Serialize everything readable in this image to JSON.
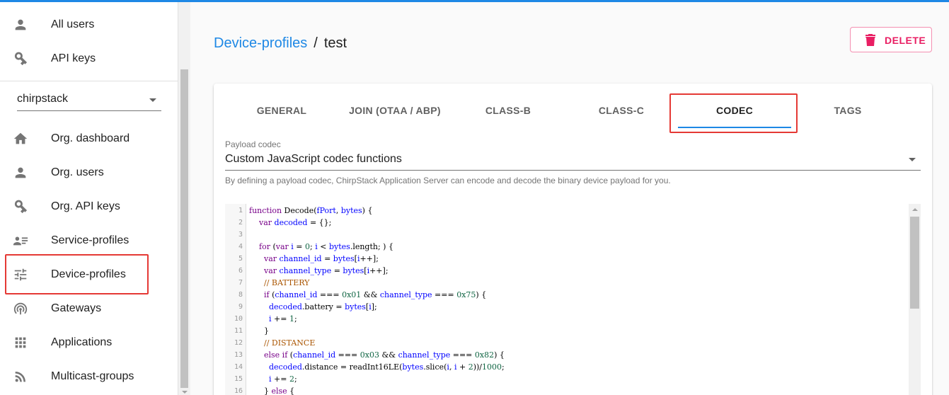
{
  "sidebar": {
    "top_items": [
      {
        "label": "All users",
        "icon": "person-icon"
      },
      {
        "label": "API keys",
        "icon": "key-icon"
      }
    ],
    "org_select": {
      "value": "chirpstack"
    },
    "org_items": [
      {
        "label": "Org. dashboard",
        "icon": "home-icon"
      },
      {
        "label": "Org. users",
        "icon": "person-icon"
      },
      {
        "label": "Org. API keys",
        "icon": "key-icon"
      },
      {
        "label": "Service-profiles",
        "icon": "account-details-icon"
      },
      {
        "label": "Device-profiles",
        "icon": "tune-icon"
      },
      {
        "label": "Gateways",
        "icon": "radio-tower-icon"
      },
      {
        "label": "Applications",
        "icon": "apps-grid-icon"
      },
      {
        "label": "Multicast-groups",
        "icon": "rss-icon"
      }
    ]
  },
  "header": {
    "breadcrumb_link": "Device-profiles",
    "breadcrumb_sep": "/",
    "breadcrumb_current": "test",
    "delete_label": "DELETE"
  },
  "tabs": [
    "GENERAL",
    "JOIN (OTAA / ABP)",
    "CLASS-B",
    "CLASS-C",
    "CODEC",
    "TAGS"
  ],
  "active_tab": "CODEC",
  "codec": {
    "field_label": "Payload codec",
    "value": "Custom JavaScript codec functions",
    "helper": "By defining a payload codec, ChirpStack Application Server can encode and decode the binary device payload for you."
  },
  "code_lines": [
    "function Decode(fPort, bytes) {",
    "    var decoded = {};",
    "",
    "    for (var i = 0; i < bytes.length; ) {",
    "      var channel_id = bytes[i++];",
    "      var channel_type = bytes[i++];",
    "      // BATTERY",
    "      if (channel_id === 0x01 && channel_type === 0x75) {",
    "        decoded.battery = bytes[i];",
    "        i += 1;",
    "      }",
    "      // DISTANCE",
    "      else if (channel_id === 0x03 && channel_type === 0x82) {",
    "        decoded.distance = readInt16LE(bytes.slice(i, i + 2))/1000;",
    "        i += 2;",
    "      } else {"
  ],
  "colors": {
    "accent": "#1e88e5",
    "delete": "#e91e63",
    "highlight": "#e53935"
  }
}
